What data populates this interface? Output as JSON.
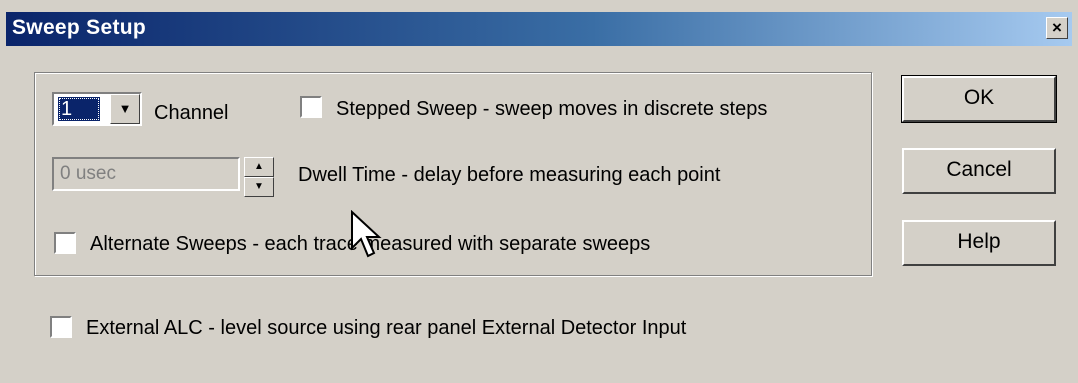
{
  "window": {
    "title": "Sweep Setup",
    "close_glyph": "×"
  },
  "channel": {
    "selected": "1",
    "label": "Channel",
    "arrow_icon": "▼"
  },
  "stepped_sweep": {
    "checked": false,
    "label": "Stepped Sweep - sweep moves in discrete steps"
  },
  "dwell_time": {
    "value": "0 usec",
    "label": "Dwell Time - delay before measuring each point",
    "up_icon": "▲",
    "down_icon": "▼"
  },
  "alternate_sweeps": {
    "checked": false,
    "label": "Alternate Sweeps - each trace measured with separate sweeps"
  },
  "external_alc": {
    "checked": false,
    "label": "External ALC  - level source using rear panel External Detector Input"
  },
  "buttons": {
    "ok": "OK",
    "cancel": "Cancel",
    "help": "Help"
  }
}
